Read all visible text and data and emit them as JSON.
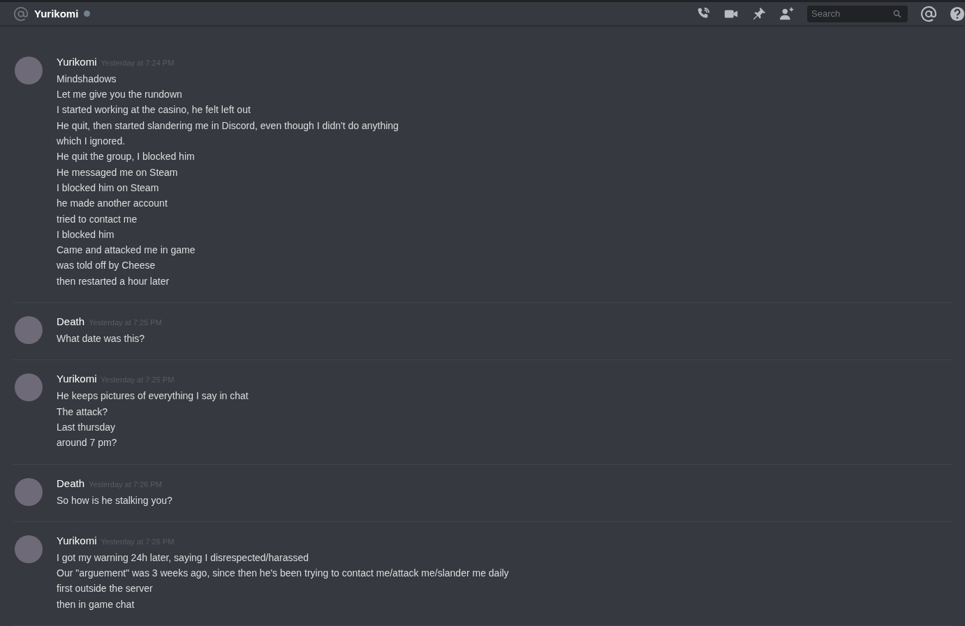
{
  "header": {
    "channel_name": "Yurikomi",
    "online": false,
    "search": {
      "placeholder": "Search"
    }
  },
  "messages": [
    {
      "author": "Yurikomi",
      "timestamp": "Yesterday at 7:24 PM",
      "lines": [
        "Mindshadows",
        "Let me give you the rundown",
        "I started working at the casino, he felt left out",
        "He quit, then started slandering me in Discord, even though I didn't do anything",
        "which I ignored.",
        "He quit the group, I blocked him",
        "He messaged me on Steam",
        "I blocked him on Steam",
        "he made another account",
        "tried to contact me",
        "I blocked him",
        "Came and attacked me in game",
        "was told off by Cheese",
        "then restarted a hour later"
      ]
    },
    {
      "author": "Death",
      "timestamp": "Yesterday at 7:25 PM",
      "lines": [
        "What date was this?"
      ]
    },
    {
      "author": "Yurikomi",
      "timestamp": "Yesterday at 7:25 PM",
      "lines": [
        "He keeps pictures of everything I say in chat",
        "The attack?",
        "Last thursday",
        "around 7 pm?"
      ]
    },
    {
      "author": "Death",
      "timestamp": "Yesterday at 7:26 PM",
      "lines": [
        "So how is he stalking you?"
      ]
    },
    {
      "author": "Yurikomi",
      "timestamp": "Yesterday at 7:26 PM",
      "lines": [
        "I got my warning 24h later, saying I disrespected/harassed",
        "Our \"arguement\" was 3 weeks ago, since then he's been trying to contact me/attack me/slander me daily",
        "first outside the server",
        "then in game chat"
      ]
    }
  ]
}
